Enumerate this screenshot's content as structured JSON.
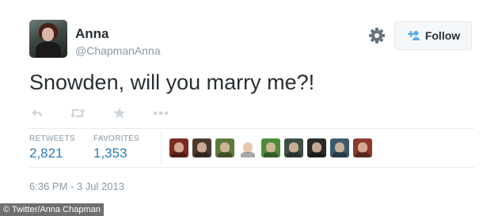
{
  "user": {
    "name": "Anna",
    "handle": "@ChapmanAnna"
  },
  "follow_button": {
    "label": "Follow",
    "icon": "add-user-icon"
  },
  "settings_icon": "gear-icon",
  "tweet": {
    "text": "Snowden, will you marry me?!",
    "timestamp": "6:36 PM - 3 Jul 2013"
  },
  "actions": [
    {
      "name": "reply",
      "icon": "reply-icon"
    },
    {
      "name": "retweet",
      "icon": "retweet-icon"
    },
    {
      "name": "favorite",
      "icon": "star-icon"
    },
    {
      "name": "more",
      "icon": "ellipsis-icon"
    }
  ],
  "stats": {
    "retweets_label": "RETWEETS",
    "retweets_count": "2,821",
    "favorites_label": "FAVORITES",
    "favorites_count": "1,353"
  },
  "favoriter_avatars": [
    {
      "color": "#7a2a22"
    },
    {
      "color": "#4a3a2e"
    },
    {
      "color": "#5d7a3c"
    },
    {
      "color": "#ffffff"
    },
    {
      "color": "#4f8a3a"
    },
    {
      "color": "#3d4e45"
    },
    {
      "color": "#2a2a2a"
    },
    {
      "color": "#3b5a6e"
    },
    {
      "color": "#8a3a2a"
    }
  ],
  "image_credit": "© Twitter/Anna Chapman",
  "colors": {
    "link_blue": "#2b7bb9",
    "muted_gray": "#8899a6",
    "text_dark": "#292f33"
  }
}
